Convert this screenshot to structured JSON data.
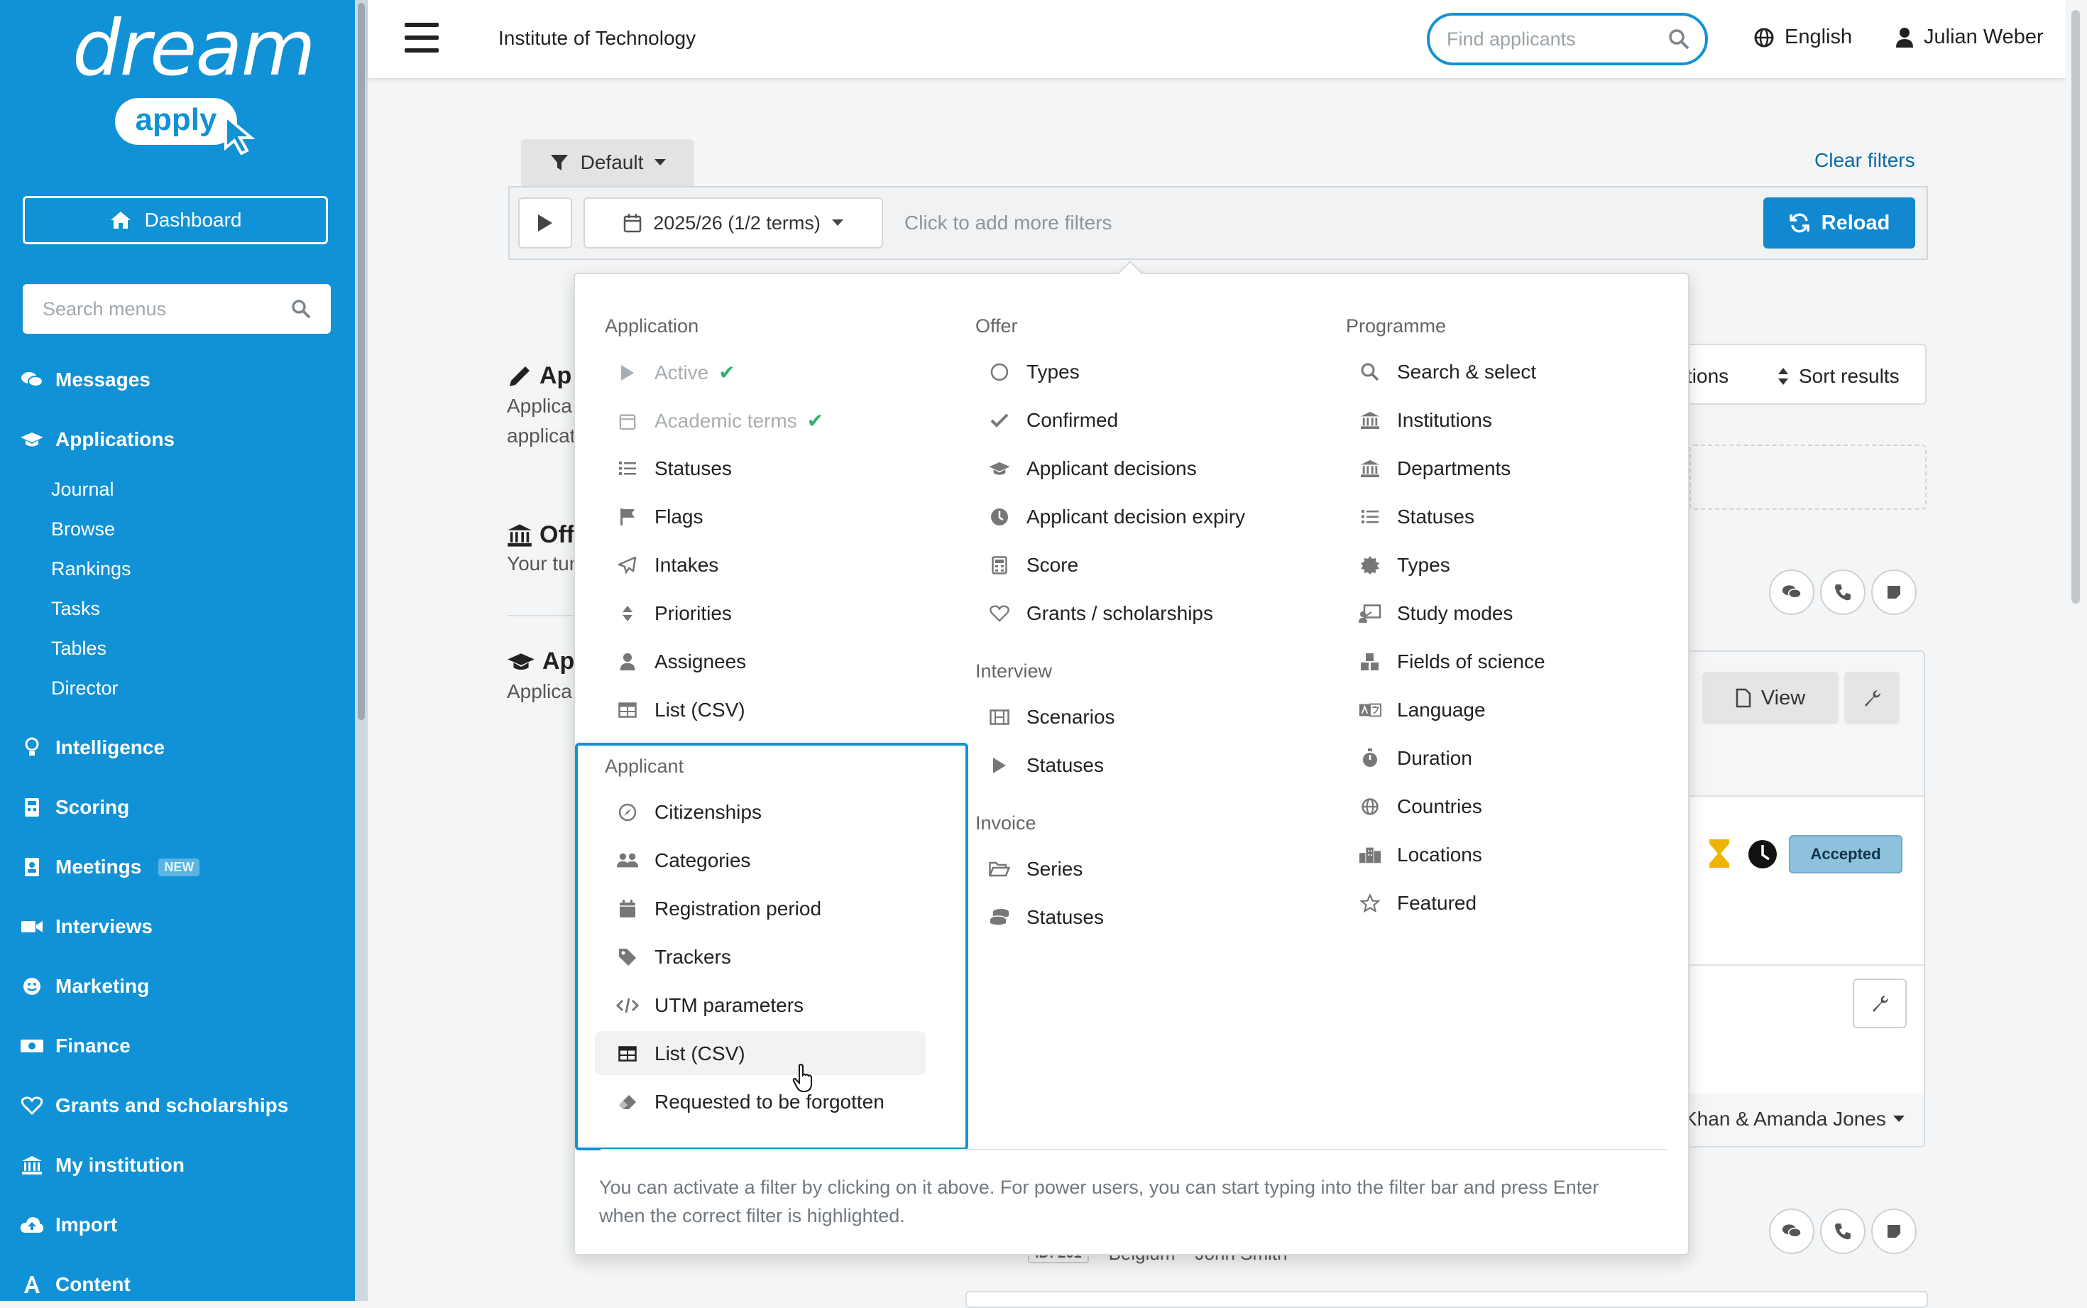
{
  "sidebar": {
    "logo_top": "dream",
    "logo_bottom": "apply",
    "dashboard_label": "Dashboard",
    "search_placeholder": "Search menus",
    "items": [
      {
        "label": "Messages",
        "icon": "comments-icon"
      },
      {
        "label": "Applications",
        "icon": "graduation-cap-icon"
      },
      {
        "label": "Intelligence",
        "icon": "lightbulb-icon"
      },
      {
        "label": "Scoring",
        "icon": "calculator-icon"
      },
      {
        "label": "Meetings",
        "icon": "address-book-icon",
        "badge": "NEW"
      },
      {
        "label": "Interviews",
        "icon": "video-icon"
      },
      {
        "label": "Marketing",
        "icon": "smile-icon"
      },
      {
        "label": "Finance",
        "icon": "money-icon"
      },
      {
        "label": "Grants and scholarships",
        "icon": "heart-icon"
      },
      {
        "label": "My institution",
        "icon": "institution-icon"
      },
      {
        "label": "Import",
        "icon": "cloud-upload-icon"
      },
      {
        "label": "Content",
        "icon": "font-icon"
      }
    ],
    "applications_sub": [
      "Journal",
      "Browse",
      "Rankings",
      "Tasks",
      "Tables",
      "Director"
    ]
  },
  "topbar": {
    "institution": "Institute of Technology",
    "find_placeholder": "Find applicants",
    "language": "English",
    "user": "Julian Weber"
  },
  "filters": {
    "preset": "Default",
    "clear": "Clear filters",
    "term": "2025/26 (1/2 terms)",
    "add_more": "Click to add more filters",
    "reload": "Reload"
  },
  "background": {
    "h1": "Ap",
    "t1a": "Applica",
    "t1b": "applicat",
    "h2": "Off",
    "t2": "Your tur",
    "h3": "Ap",
    "t3": "Applica",
    "options_fragment": "tions",
    "sort": "Sort results",
    "view": "View",
    "status": "Accepted",
    "assignees": "Khan & Amanda Jones",
    "row_id": "ID: 261",
    "row_country": "Belgium",
    "row_person": "John Smith"
  },
  "dropdown": {
    "application": {
      "heading": "Application",
      "items": [
        {
          "label": "Active",
          "icon": "play-icon",
          "active": true
        },
        {
          "label": "Academic terms",
          "icon": "calendar-icon",
          "active": true
        },
        {
          "label": "Statuses",
          "icon": "list-icon"
        },
        {
          "label": "Flags",
          "icon": "flag-icon"
        },
        {
          "label": "Intakes",
          "icon": "paper-plane-icon"
        },
        {
          "label": "Priorities",
          "icon": "sort-icon"
        },
        {
          "label": "Assignees",
          "icon": "user-icon"
        },
        {
          "label": "List (CSV)",
          "icon": "table-icon"
        }
      ]
    },
    "applicant": {
      "heading": "Applicant",
      "items": [
        {
          "label": "Citizenships",
          "icon": "compass-icon"
        },
        {
          "label": "Categories",
          "icon": "users-icon"
        },
        {
          "label": "Registration period",
          "icon": "calendar-icon"
        },
        {
          "label": "Trackers",
          "icon": "tag-icon"
        },
        {
          "label": "UTM parameters",
          "icon": "code-icon"
        },
        {
          "label": "List (CSV)",
          "icon": "table-icon"
        },
        {
          "label": "Requested to be forgotten",
          "icon": "eraser-icon"
        }
      ]
    },
    "offer": {
      "heading": "Offer",
      "items": [
        {
          "label": "Types",
          "icon": "circle-icon"
        },
        {
          "label": "Confirmed",
          "icon": "check-icon"
        },
        {
          "label": "Applicant decisions",
          "icon": "graduation-cap-icon"
        },
        {
          "label": "Applicant decision expiry",
          "icon": "clock-icon"
        },
        {
          "label": "Score",
          "icon": "calculator-icon"
        },
        {
          "label": "Grants / scholarships",
          "icon": "heart-icon"
        }
      ]
    },
    "interview": {
      "heading": "Interview",
      "items": [
        {
          "label": "Scenarios",
          "icon": "film-icon"
        },
        {
          "label": "Statuses",
          "icon": "play-icon"
        }
      ]
    },
    "invoice": {
      "heading": "Invoice",
      "items": [
        {
          "label": "Series",
          "icon": "folder-open-icon"
        },
        {
          "label": "Statuses",
          "icon": "database-icon"
        }
      ]
    },
    "programme": {
      "heading": "Programme",
      "items": [
        {
          "label": "Search & select",
          "icon": "search-icon"
        },
        {
          "label": "Institutions",
          "icon": "institution-icon"
        },
        {
          "label": "Departments",
          "icon": "institution-icon"
        },
        {
          "label": "Statuses",
          "icon": "list-icon"
        },
        {
          "label": "Types",
          "icon": "certificate-icon"
        },
        {
          "label": "Study modes",
          "icon": "chalkboard-icon"
        },
        {
          "label": "Fields of science",
          "icon": "cubes-icon"
        },
        {
          "label": "Language",
          "icon": "language-icon"
        },
        {
          "label": "Duration",
          "icon": "stopwatch-icon"
        },
        {
          "label": "Countries",
          "icon": "globe-icon"
        },
        {
          "label": "Locations",
          "icon": "city-icon"
        },
        {
          "label": "Featured",
          "icon": "star-icon"
        }
      ]
    },
    "hint": "You can activate a filter by clicking on it above. For power users, you can start typing into the filter bar and press Enter when the correct filter is highlighted."
  },
  "colors": {
    "brand": "#1192d6",
    "accepted_badge": "#8dc1dc",
    "active_check": "#2ab56b"
  }
}
